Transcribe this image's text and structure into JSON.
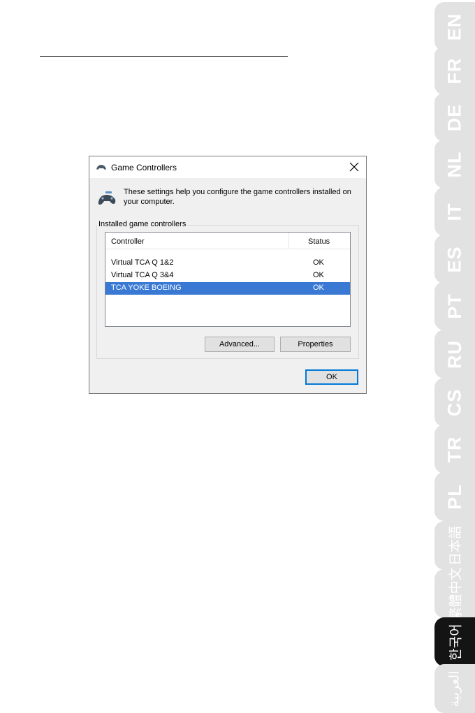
{
  "dialog": {
    "title": "Game Controllers",
    "intro": "These settings help you configure the game controllers installed on your computer.",
    "group_label": "Installed game controllers",
    "columns": {
      "controller": "Controller",
      "status": "Status"
    },
    "rows": [
      {
        "name": "Virtual TCA Q 1&2",
        "status": "OK"
      },
      {
        "name": "Virtual TCA Q 3&4",
        "status": "OK"
      },
      {
        "name": "TCA YOKE BOEING",
        "status": "OK"
      }
    ],
    "selected_row": 2,
    "buttons": {
      "advanced": "Advanced...",
      "properties": "Properties",
      "ok": "OK"
    }
  },
  "language_tabs": [
    {
      "label": "EN"
    },
    {
      "label": "FR"
    },
    {
      "label": "DE"
    },
    {
      "label": "NL"
    },
    {
      "label": "IT"
    },
    {
      "label": "ES"
    },
    {
      "label": "PT"
    },
    {
      "label": "RU"
    },
    {
      "label": "CS"
    },
    {
      "label": "TR"
    },
    {
      "label": "PL"
    },
    {
      "label": "日本語"
    },
    {
      "label": "繁體中文"
    },
    {
      "label": "한국어"
    },
    {
      "label": "العربية"
    }
  ],
  "active_language": "한국어",
  "colors": {
    "tab": "#e2e2e2",
    "tab_active": "#141414",
    "selection": "#3979d4",
    "ok_border": "#0078d7"
  }
}
